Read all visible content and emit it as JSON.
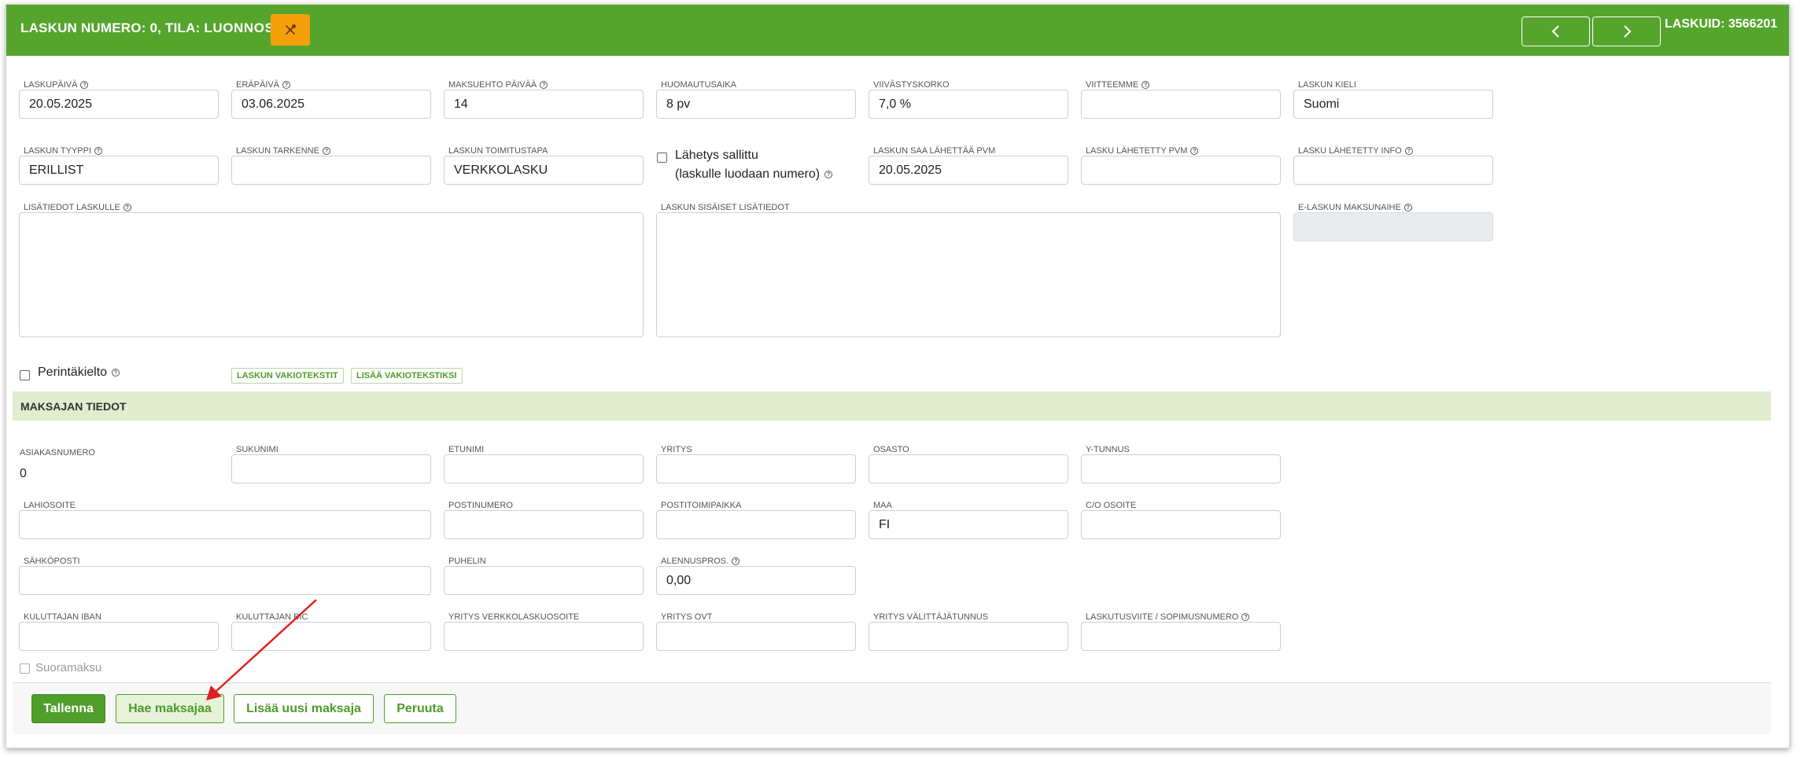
{
  "header": {
    "title_prefix": "LASKUN NUMERO: ",
    "invoice_number": "0",
    "title_mid": ", TILA: ",
    "status": "LUONNOS",
    "laskuid": "LASKUID: 3566201"
  },
  "form": {
    "laskupaiva": {
      "label": "LASKUPÄIVÄ",
      "value": "20.05.2025"
    },
    "erapaiva": {
      "label": "ERÄPÄIVÄ",
      "value": "03.06.2025"
    },
    "maksuehto": {
      "label": "MAKSUEHTO PÄIVÄÄ",
      "value": "14"
    },
    "huomautusaika": {
      "label": "HUOMAUTUSAIKA",
      "value": "8 pv"
    },
    "viivastyskorko": {
      "label": "VIIVÄSTYSKORKO",
      "value": "7,0 %"
    },
    "viitteemme": {
      "label": "VIITTEEMME",
      "value": ""
    },
    "laskun_kieli": {
      "label": "LASKUN KIELI",
      "value": "Suomi"
    },
    "laskun_tyyppi": {
      "label": "LASKUN TYYPPI",
      "value": "ERILLIST"
    },
    "laskun_tarkenne": {
      "label": "LASKUN TARKENNE",
      "value": ""
    },
    "toimitustapa": {
      "label": "LASKUN TOIMITUSTAPA",
      "value": "VERKKOLASKU"
    },
    "lahetys_line1": "Lähetys sallittu",
    "lahetys_line2": "(laskulle luodaan numero)",
    "saa_lahettaa": {
      "label": "LASKUN SAA LÄHETTÄÄ PVM",
      "value": "20.05.2025"
    },
    "lahetetty_pvm": {
      "label": "LASKU LÄHETETTY PVM",
      "value": ""
    },
    "lahetetty_info": {
      "label": "LASKU LÄHETETTY INFO",
      "value": ""
    },
    "lisatiedot": {
      "label": "LISÄTIEDOT LASKULLE",
      "value": ""
    },
    "sisaiset": {
      "label": "LASKUN SISÄISET LISÄTIEDOT",
      "value": ""
    },
    "e_maksunaihe": {
      "label": "E-LASKUN MAKSUNAIHE",
      "value": ""
    },
    "perintakielto": "Perintäkielto",
    "vakiotekstit": "LASKUN VAKIOTEKSTIT",
    "lisaa_vakioteksti": "LISÄÄ VAKIOTEKSTIKSI"
  },
  "payer": {
    "section_title": "MAKSAJAN TIEDOT",
    "asiakasnumero_label": "ASIAKASNUMERO",
    "asiakasnumero_value": "0",
    "sukunimi": {
      "label": "SUKUNIMI",
      "value": ""
    },
    "etunimi": {
      "label": "ETUNIMI",
      "value": ""
    },
    "yritys": {
      "label": "YRITYS",
      "value": ""
    },
    "osasto": {
      "label": "OSASTO",
      "value": ""
    },
    "ytunnus": {
      "label": "Y-TUNNUS",
      "value": ""
    },
    "lahiosoite": {
      "label": "LAHIOSOITE",
      "value": ""
    },
    "postinumero": {
      "label": "POSTINUMERO",
      "value": ""
    },
    "postitoimipaikka": {
      "label": "POSTITOIMIPAIKKA",
      "value": ""
    },
    "maa": {
      "label": "MAA",
      "value": "FI"
    },
    "co_osoite": {
      "label": "C/O OSOITE",
      "value": ""
    },
    "sahkoposti": {
      "label": "SÄHKÖPOSTI",
      "value": ""
    },
    "puhelin": {
      "label": "PUHELIN",
      "value": ""
    },
    "alennuspros": {
      "label": "ALENNUSPROS.",
      "value": "0,00"
    },
    "kuluttajan_iban": {
      "label": "KULUTTAJAN IBAN",
      "value": ""
    },
    "kuluttajan_bic": {
      "label": "KULUTTAJAN BIC",
      "value": ""
    },
    "verkkolaskuosoite": {
      "label": "YRITYS VERKKOLASKUOSOITE",
      "value": ""
    },
    "yritys_ovt": {
      "label": "YRITYS OVT",
      "value": ""
    },
    "valittajatunnus": {
      "label": "YRITYS VÄLITTÄJÄTUNNUS",
      "value": ""
    },
    "laskutusviite": {
      "label": "LASKUTUSVIITE / SOPIMUSNUMERO",
      "value": ""
    },
    "suoramaksu": "Suoramaksu"
  },
  "actions": {
    "tallenna": "Tallenna",
    "hae_maksajaa": "Hae maksajaa",
    "lisaa_uusi_maksaja": "Lisää uusi maksaja",
    "peruuta": "Peruuta"
  },
  "colors": {
    "header_green": "#55a52d",
    "accent_orange": "#f5a00a",
    "section_bg": "#e1edcf",
    "arrow_red": "#e02020"
  },
  "icons": {
    "tools": "tools-icon",
    "prev": "chevron-left-icon",
    "next": "chevron-right-icon",
    "help": "question-circle-icon"
  }
}
